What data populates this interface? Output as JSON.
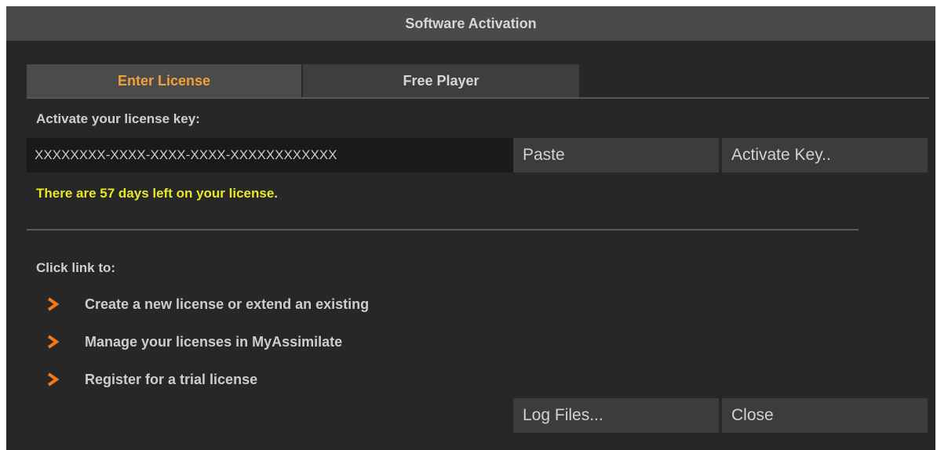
{
  "window": {
    "title": "Software Activation"
  },
  "tabs": [
    {
      "label": "Enter License",
      "active": true
    },
    {
      "label": "Free Player",
      "active": false
    }
  ],
  "license": {
    "prompt": "Activate your license key:",
    "key_value": "XXXXXXXX-XXXX-XXXX-XXXX-XXXXXXXXXXXX",
    "paste_label": "Paste",
    "activate_label": "Activate Key..",
    "status": "There are 57 days left on your license."
  },
  "links": {
    "heading": "Click link to:",
    "items": [
      {
        "label": "Create a new license or extend an existing",
        "icon": "chevron-right-icon"
      },
      {
        "label": "Manage your licenses in MyAssimilate",
        "icon": "chevron-right-icon"
      },
      {
        "label": "Register for a trial license",
        "icon": "chevron-right-icon"
      }
    ]
  },
  "footer": {
    "log_files_label": "Log Files...",
    "close_label": "Close"
  },
  "colors": {
    "accent": "#f2a03a",
    "status": "#e8e82a",
    "chevron": "#f07a1a",
    "background": "#272727",
    "titlebar": "#4a4a4a"
  }
}
